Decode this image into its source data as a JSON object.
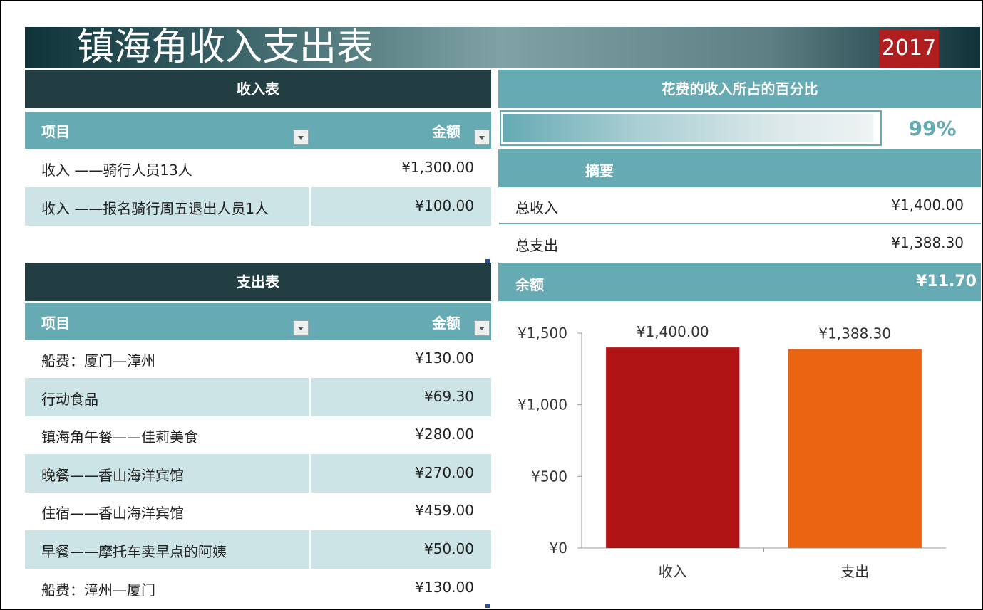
{
  "title": "镇海角收入支出表",
  "year": "2017",
  "income": {
    "heading": "收入表",
    "col_item": "项目",
    "col_amount": "金额",
    "rows": [
      {
        "item": "收入 ——骑行人员13人",
        "amount": "¥1,300.00"
      },
      {
        "item": "收入 ——报名骑行周五退出人员1人",
        "amount": "¥100.00"
      }
    ]
  },
  "expense": {
    "heading": "支出表",
    "col_item": "项目",
    "col_amount": "金额",
    "rows": [
      {
        "item": "船费：厦门—漳州",
        "amount": "¥130.00"
      },
      {
        "item": "行动食品",
        "amount": "¥69.30"
      },
      {
        "item": "镇海角午餐——佳莉美食",
        "amount": "¥280.00"
      },
      {
        "item": "晚餐——香山海洋宾馆",
        "amount": "¥270.00"
      },
      {
        "item": "住宿——香山海洋宾馆",
        "amount": "¥459.00"
      },
      {
        "item": "早餐——摩托车卖早点的阿姨",
        "amount": "¥50.00"
      },
      {
        "item": "船费：漳州—厦门",
        "amount": "¥130.00"
      }
    ]
  },
  "percent": {
    "heading": "花费的收入所占的百分比",
    "value_text": "99%",
    "fill_fraction": 0.99
  },
  "summary": {
    "heading": "摘要",
    "total_income_label": "总收入",
    "total_income": "¥1,400.00",
    "total_expense_label": "总支出",
    "total_expense": "¥1,388.30",
    "balance_label": "余额",
    "balance": "¥11.70"
  },
  "colors": {
    "dark_header": "#223e42",
    "teal": "#66aab4",
    "band": "#cde4e6",
    "year_badge": "#b01f1f",
    "income_bar": "#b01414",
    "expense_bar": "#ea6412"
  },
  "chart_data": {
    "type": "bar",
    "categories": [
      "收入",
      "支出"
    ],
    "values": [
      1400.0,
      1388.3
    ],
    "data_labels": [
      "¥1,400.00",
      "¥1,388.30"
    ],
    "y_ticks": [
      0,
      500,
      1000,
      1500
    ],
    "y_tick_labels": [
      "¥0",
      "¥500",
      "¥1,000",
      "¥1,500"
    ],
    "ylim": [
      0,
      1500
    ],
    "grid": false,
    "legend": "none",
    "bar_colors": [
      "#b01414",
      "#ea6412"
    ]
  }
}
